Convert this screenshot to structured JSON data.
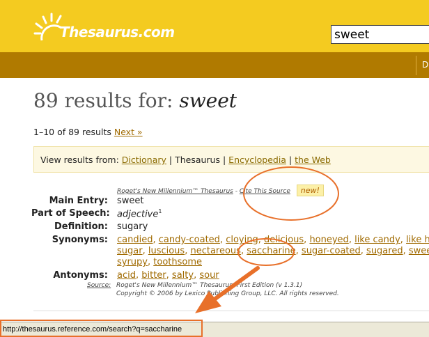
{
  "header": {
    "logo_text": "Thesaurus.com",
    "search_value": "sweet",
    "nav_tab_label": "D"
  },
  "results": {
    "count": "89",
    "title_prefix": " results for: ",
    "term": "sweet",
    "range_text": "1–10 of 89 results",
    "next_label": "Next »"
  },
  "view_from": {
    "label": "View results from:",
    "dictionary": "Dictionary",
    "sep1": " | ",
    "thesaurus": "Thesaurus",
    "sep2": " | ",
    "encyclopedia": "Encyclopedia",
    "sep3": " | ",
    "web": "the Web"
  },
  "entry": {
    "source_title": "Roget's New Millennium™ Thesaurus",
    "source_sep": " - ",
    "cite_label": "Cite This Source",
    "new_badge": "new!",
    "main_entry_label": "Main Entry:",
    "main_entry_value": "sweet",
    "pos_label": "Part of Speech:",
    "pos_value": "adjective",
    "pos_sup": "1",
    "definition_label": "Definition:",
    "definition_value": "sugary",
    "synonyms_label": "Synonyms:",
    "synonyms_line1": [
      "candied",
      "candy-coated",
      "cloying",
      "delicious",
      "honeyed",
      "like candy",
      "like hon"
    ],
    "synonyms_line2": [
      "sugar",
      "luscious",
      "nectareous",
      "saccharine",
      "sugar-coated",
      "sugared",
      "sweete"
    ],
    "synonyms_line3": [
      "syrupy",
      "toothsome"
    ],
    "antonyms_label": "Antonyms:",
    "antonyms": [
      "acid",
      "bitter",
      "salty",
      "sour"
    ],
    "source_label": "Source:",
    "source_edition": "Roget's New Millennium™ Thesaurus, First Edition (v 1.3.1)",
    "copyright": "Copyright © 2006 by Lexico Publishing Group, LLC. All rights reserved."
  },
  "statusbar": {
    "url": "http://thesaurus.reference.com/search?q=saccharine"
  },
  "colors": {
    "header_yellow": "#f4cb20",
    "nav_brown": "#b07a00",
    "link_gold": "#a06a00",
    "annotation_orange": "#e8702a"
  }
}
